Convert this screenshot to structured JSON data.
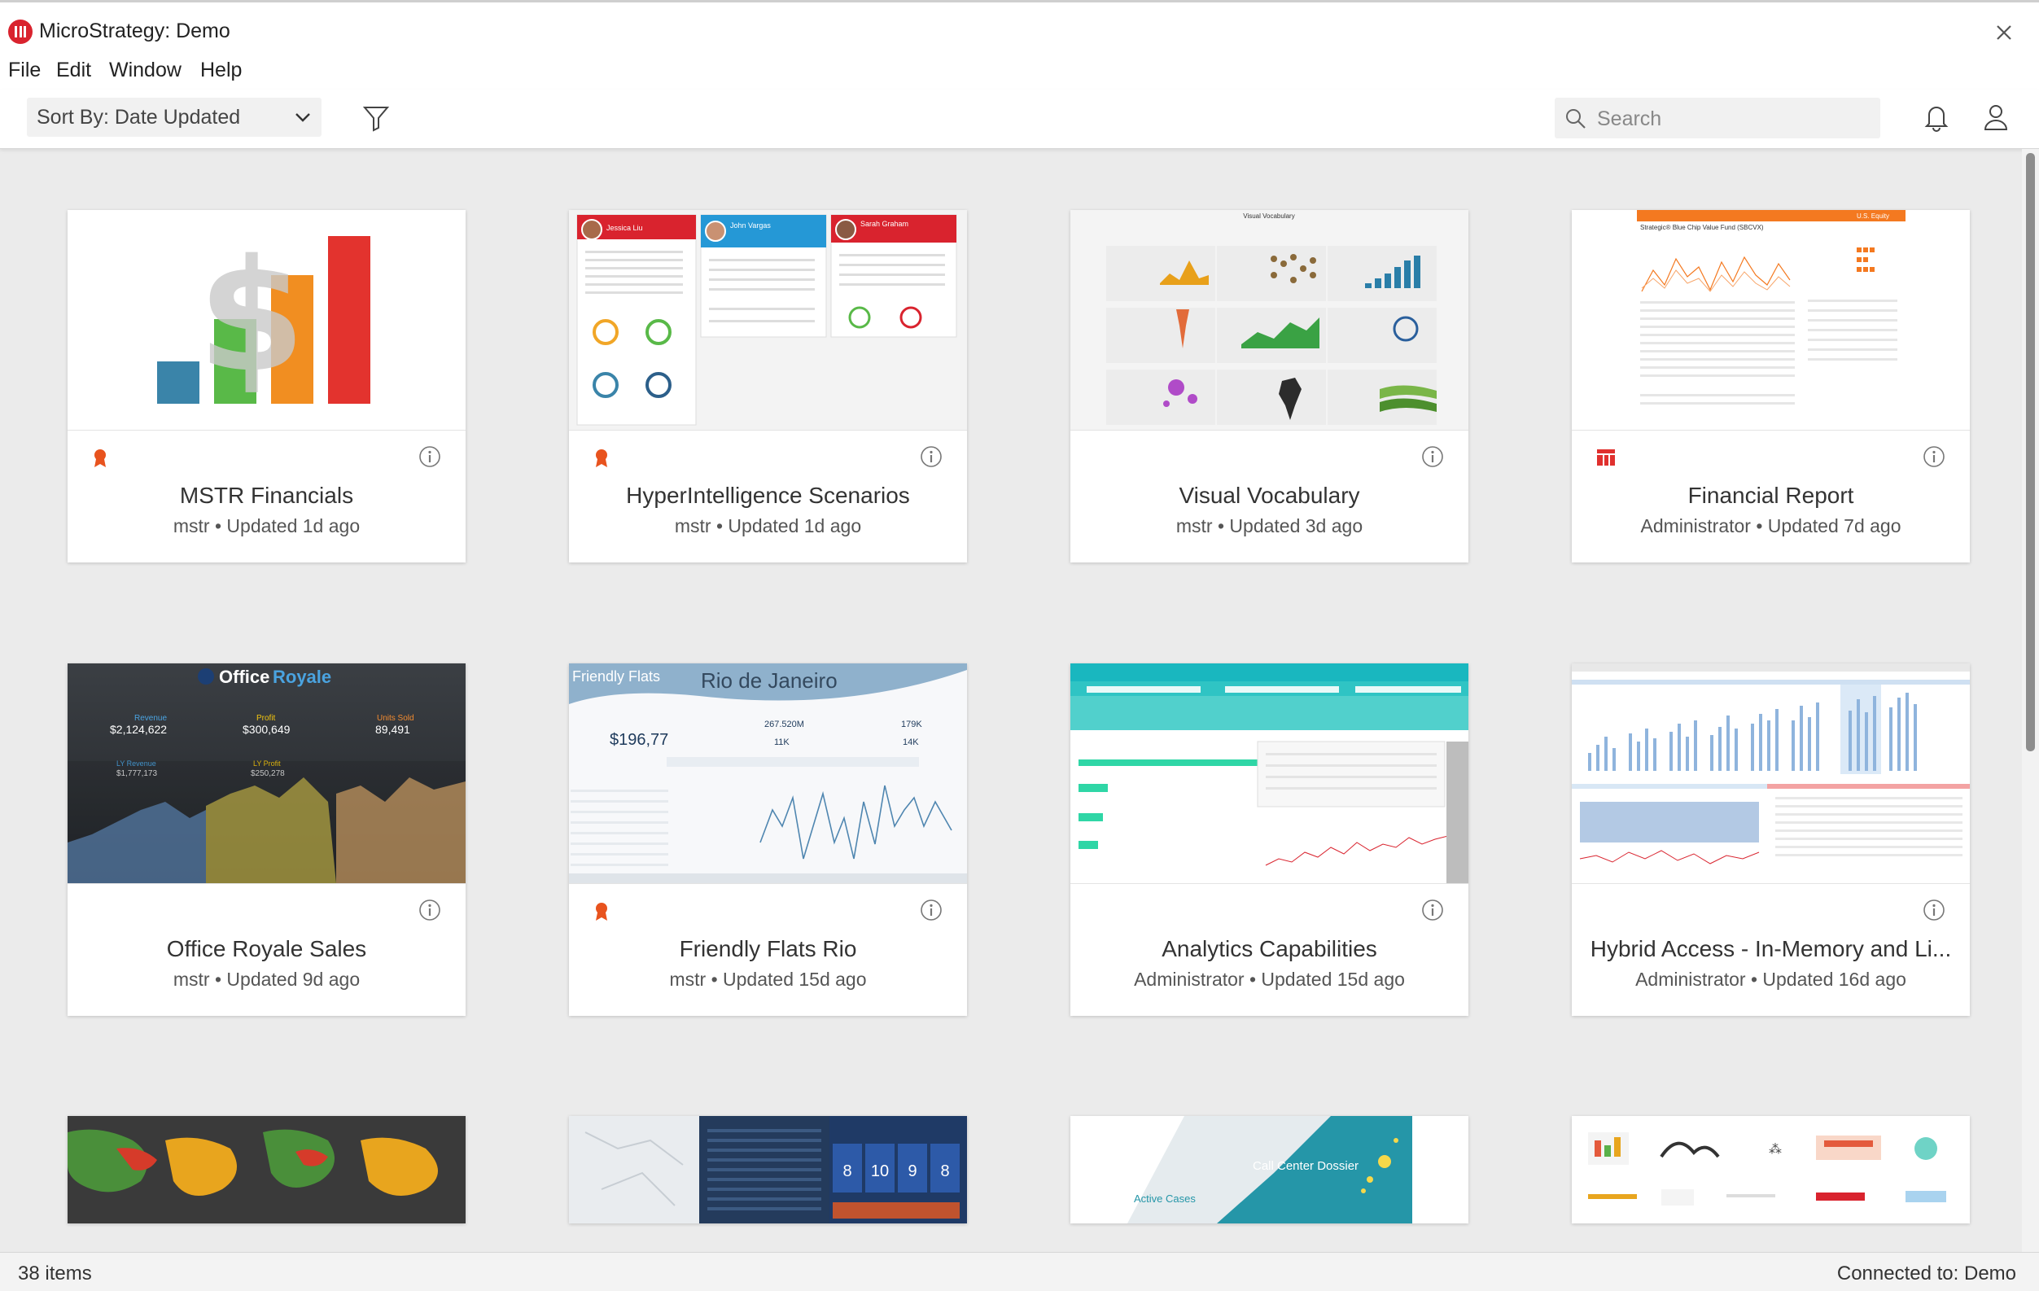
{
  "window": {
    "title": "MicroStrategy: Demo"
  },
  "menu": {
    "file": "File",
    "edit": "Edit",
    "window": "Window",
    "help": "Help"
  },
  "toolbar": {
    "sort_label": "Sort By: Date Updated",
    "search_placeholder": "Search"
  },
  "cards": [
    {
      "title": "MSTR Financials",
      "meta": "mstr • Updated 1d ago",
      "certified": true,
      "type_icon": ""
    },
    {
      "title": "HyperIntelligence Scenarios",
      "meta": "mstr • Updated 1d ago",
      "certified": true,
      "type_icon": ""
    },
    {
      "title": "Visual Vocabulary",
      "meta": "mstr • Updated 3d ago",
      "certified": false,
      "type_icon": ""
    },
    {
      "title": "Financial Report",
      "meta": "Administrator • Updated 7d ago",
      "certified": false,
      "type_icon": "document-icon"
    },
    {
      "title": "Office Royale Sales",
      "meta": "mstr • Updated 9d ago",
      "certified": false,
      "type_icon": ""
    },
    {
      "title": "Friendly Flats Rio",
      "meta": "mstr • Updated 15d ago",
      "certified": true,
      "type_icon": ""
    },
    {
      "title": "Analytics Capabilities",
      "meta": "Administrator • Updated 15d ago",
      "certified": false,
      "type_icon": ""
    },
    {
      "title": "Hybrid Access - In-Memory and Li...",
      "meta": "Administrator • Updated 16d ago",
      "certified": false,
      "type_icon": ""
    }
  ],
  "thumbs": {
    "hyper": {
      "p1": "Jessica Liu",
      "p2": "John Vargas",
      "p3": "Sarah Graham"
    },
    "vocab": {
      "title": "Visual Vocabulary"
    },
    "fin": {
      "title": "Strategic® Blue Chip Value Fund (SBCVX)",
      "tag": "U.S. Equity"
    },
    "office": {
      "brand_a": "Office",
      "brand_b": "Royale",
      "kpi1_label": "Revenue",
      "kpi1_value": "$2,124,622",
      "kpi2_label": "Profit",
      "kpi2_value": "$300,649",
      "kpi3_label": "Units Sold",
      "kpi3_value": "89,491",
      "kpi4_label": "LY Revenue",
      "kpi4_value": "$1,777,173",
      "kpi5_label": "LY Profit",
      "kpi5_value": "$250,278"
    },
    "rio": {
      "brand": "Friendly Flats",
      "city": "Rio de Janeiro",
      "avg_price": "$196,77",
      "m1": "267.520M",
      "m2": "11K",
      "m3": "179K",
      "m4": "14K"
    },
    "callcenter": {
      "title": "Call Center Dossier",
      "sub": "Active Cases"
    },
    "kpis": [
      "8",
      "10",
      "9",
      "8"
    ]
  },
  "status": {
    "items": "38 items",
    "connected": "Connected to: Demo"
  },
  "colors": {
    "brand_red": "#d9232e",
    "cert_orange": "#e8531e"
  }
}
